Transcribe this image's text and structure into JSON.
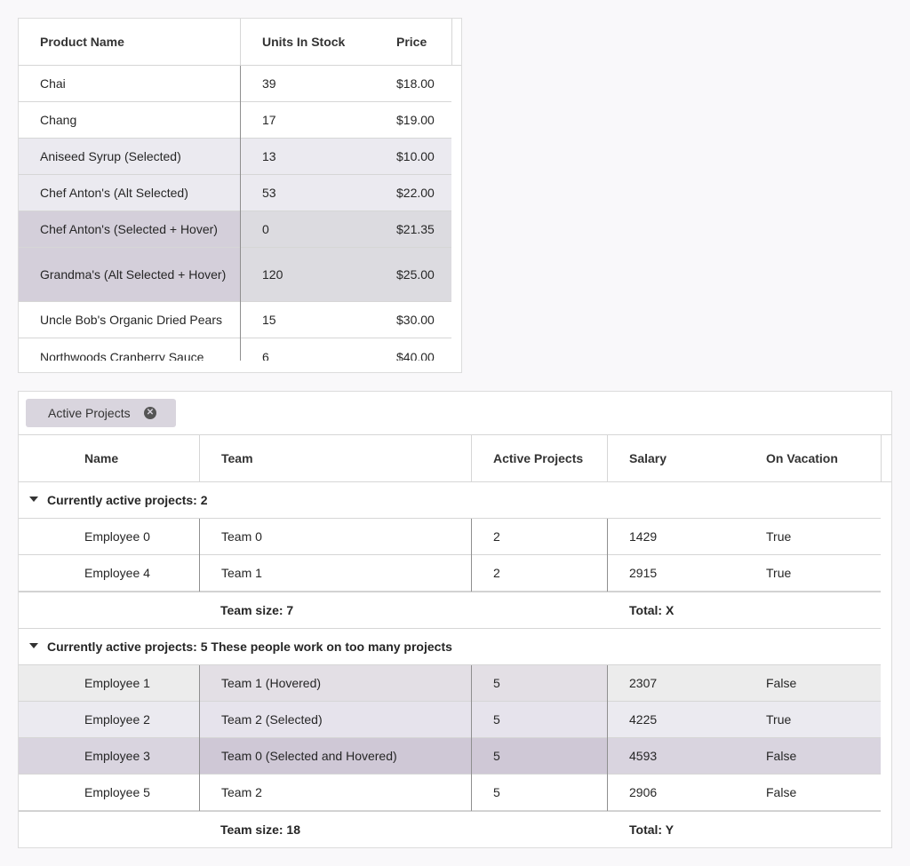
{
  "products_grid": {
    "columns": [
      "Product Name",
      "Units In Stock",
      "Price"
    ],
    "rows": [
      {
        "name": "Chai",
        "units": "39",
        "price": "$18.00",
        "state": "normal"
      },
      {
        "name": "Chang",
        "units": "17",
        "price": "$19.00",
        "state": "normal"
      },
      {
        "name": "Aniseed Syrup (Selected)",
        "units": "13",
        "price": "$10.00",
        "state": "selected"
      },
      {
        "name": "Chef Anton's (Alt Selected)",
        "units": "53",
        "price": "$22.00",
        "state": "alt-selected"
      },
      {
        "name": "Chef Anton's (Selected + Hover)",
        "units": "0",
        "price": "$21.35",
        "state": "selected-hover"
      },
      {
        "name": "Grandma's (Alt Selected + Hover)",
        "units": "120",
        "price": "$25.00",
        "state": "alt-selected-hover"
      },
      {
        "name": "Uncle Bob's Organic Dried Pears",
        "units": "15",
        "price": "$30.00",
        "state": "normal"
      },
      {
        "name": "Northwoods Cranberry Sauce",
        "units": "6",
        "price": "$40.00",
        "state": "normal"
      }
    ]
  },
  "employees_grid": {
    "group_chip": {
      "label": "Active Projects",
      "remove_icon": "close-circle-icon"
    },
    "columns": [
      "Name",
      "Team",
      "Active Projects",
      "Salary",
      "On Vacation"
    ],
    "groups": [
      {
        "header": "Currently active projects: 2",
        "rows": [
          {
            "name": "Employee 0",
            "team": "Team 0",
            "projects": "2",
            "salary": "1429",
            "vacation": "True",
            "state": "normal"
          },
          {
            "name": "Employee 4",
            "team": "Team 1",
            "projects": "2",
            "salary": "2915",
            "vacation": "True",
            "state": "normal"
          }
        ],
        "footer": {
          "team_size": "Team size: 7",
          "total": "Total: X"
        }
      },
      {
        "header": "Currently active projects: 5  These people work on too many projects",
        "rows": [
          {
            "name": "Employee 1",
            "team": "Team 1 (Hovered)",
            "projects": "5",
            "salary": "2307",
            "vacation": "False",
            "state": "hover"
          },
          {
            "name": "Employee 2",
            "team": "Team 2 (Selected)",
            "projects": "5",
            "salary": "4225",
            "vacation": "True",
            "state": "selected"
          },
          {
            "name": "Employee 3",
            "team": "Team 0 (Selected and Hovered)",
            "projects": "5",
            "salary": "4593",
            "vacation": "False",
            "state": "selected-hover"
          },
          {
            "name": "Employee 5",
            "team": "Team 2",
            "projects": "5",
            "salary": "2906",
            "vacation": "False",
            "state": "normal"
          }
        ],
        "footer": {
          "team_size": "Team size: 18",
          "total": "Total: Y"
        }
      }
    ]
  },
  "colors": {
    "selected": "#ebeaf0",
    "selected_hover": "#d9d4df",
    "hover": "#ececec",
    "chip": "#d9d5de"
  }
}
